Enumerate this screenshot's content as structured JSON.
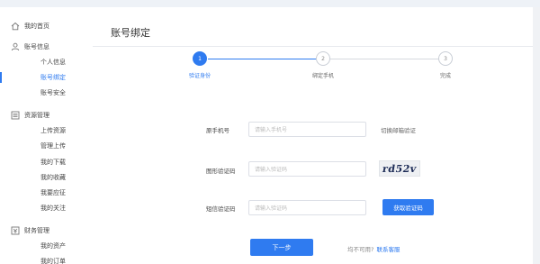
{
  "sidebar": {
    "home": {
      "label": "我的首页",
      "icon": "home-icon"
    },
    "account": {
      "label": "账号信息",
      "icon": "user-icon",
      "items": [
        "个人信息",
        "账号绑定",
        "账号安全"
      ],
      "active_index": 1
    },
    "resources": {
      "label": "资源管理",
      "icon": "list-icon",
      "items": [
        "上传资源",
        "管理上传",
        "我的下载",
        "我的收藏",
        "我要应征",
        "我的关注"
      ]
    },
    "finance": {
      "label": "财务管理",
      "icon": "money-icon",
      "items": [
        "我的资产",
        "我的订单"
      ]
    }
  },
  "main": {
    "title": "账号绑定",
    "steps": [
      {
        "number": "1",
        "label": "验证身份",
        "active": true
      },
      {
        "number": "2",
        "label": "绑定手机",
        "active": false
      },
      {
        "number": "3",
        "label": "完成",
        "active": false
      }
    ],
    "form": {
      "phone": {
        "label": "原手机号",
        "placeholder": "请输入手机号"
      },
      "switch_email": "切换邮箱验证",
      "captcha": {
        "label": "图形验证码",
        "placeholder": "请输入验证码",
        "image_text": "rd52v"
      },
      "sms": {
        "label": "短信验证码",
        "placeholder": "请输入验证码",
        "button": "获取验证码"
      }
    },
    "next_button": "下一步",
    "help": {
      "text": "均不可用?",
      "link": "联系客服"
    }
  },
  "colors": {
    "accent": "#2f7bf0",
    "sidebar_bg": "#ffffff",
    "page_bg": "#f4f7fb"
  }
}
